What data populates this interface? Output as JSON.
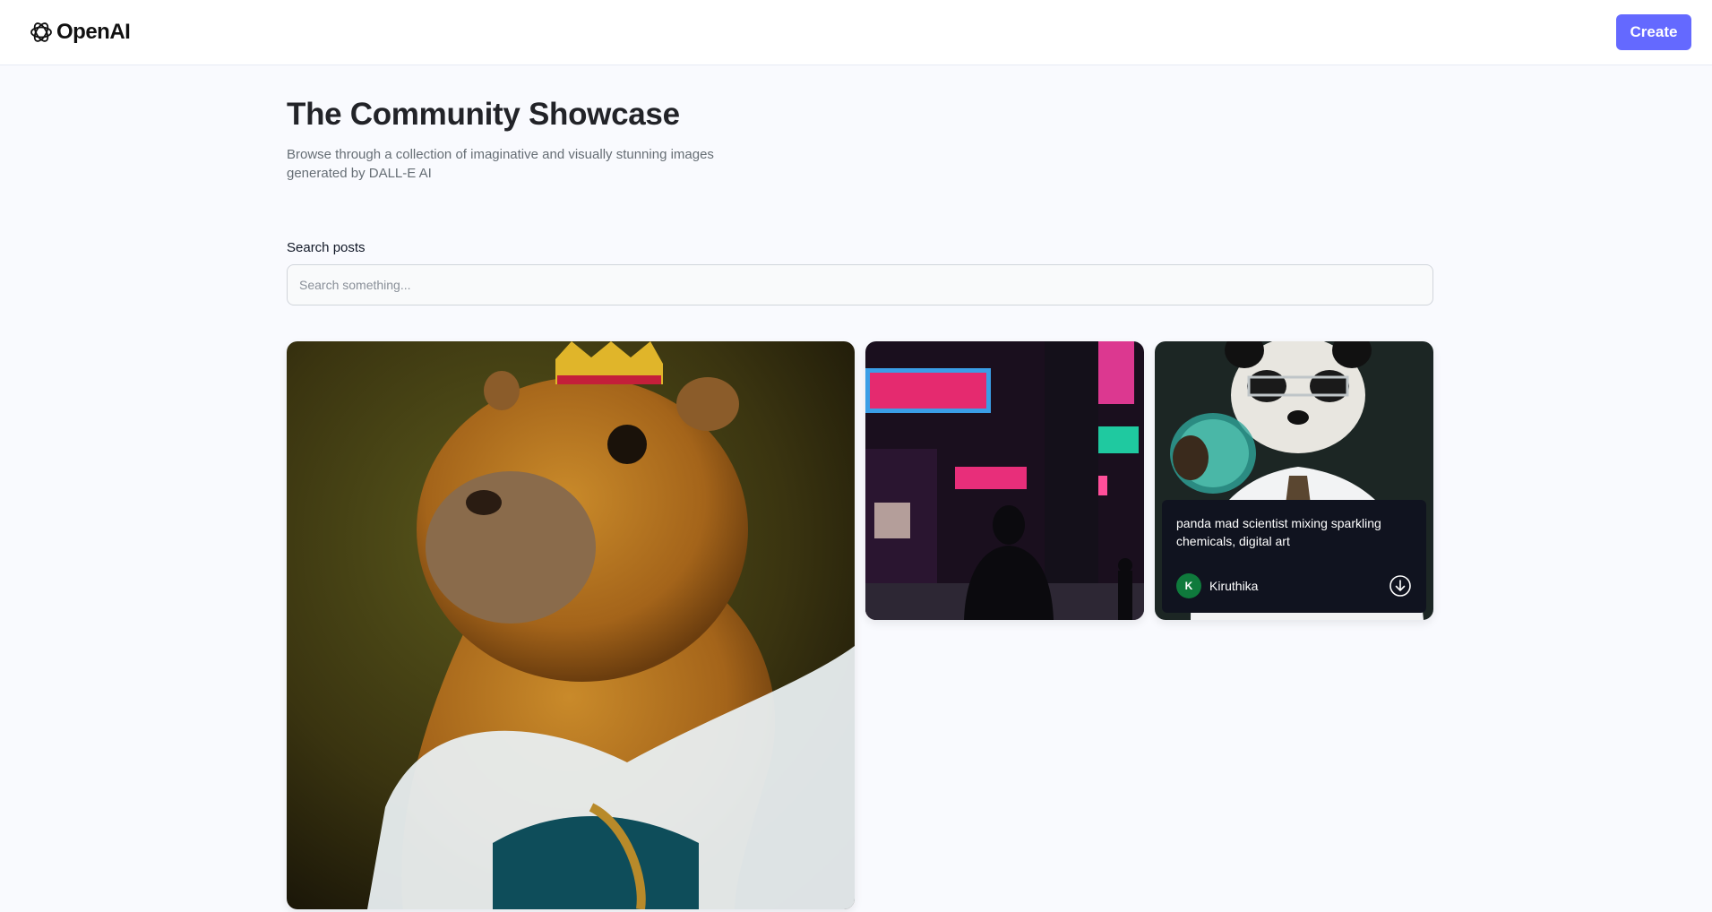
{
  "header": {
    "brand": "OpenAI",
    "create_label": "Create",
    "accent_color": "#6469ff"
  },
  "main": {
    "title": "The Community Showcase",
    "subtitle": "Browse through a collection of imaginative and visually stunning images generated by DALL-E AI",
    "search": {
      "label": "Search posts",
      "placeholder": "Search something...",
      "value": ""
    }
  },
  "posts": [
    {
      "image": "capybara-king-portrait"
    },
    {
      "image": "neon-night-street"
    },
    {
      "image": "panda-scientist",
      "prompt": "panda mad scientist mixing sparkling chemicals, digital art",
      "author": "Kiruthika",
      "author_initial": "K",
      "avatar_color": "#0f7a3c",
      "download_icon": "download-icon"
    }
  ]
}
